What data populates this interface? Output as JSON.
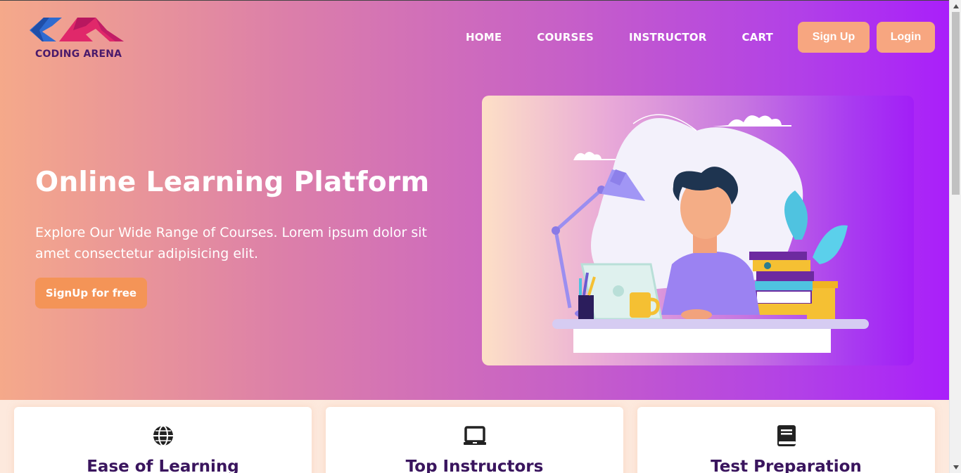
{
  "brand": {
    "name": "CODING ARENA",
    "logo_colors": {
      "left": "#2f6bd0",
      "right": "#e0286a"
    }
  },
  "nav": {
    "links": [
      "HOME",
      "COURSES",
      "INSTRUCTOR",
      "CART"
    ],
    "signup_label": "Sign Up",
    "login_label": "Login"
  },
  "hero": {
    "title": "Online Learning Platform",
    "subtitle": "Explore Our Wide Range of Courses. Lorem ipsum dolor sit amet consectetur adipisicing elit.",
    "cta_label": "SignUp for free",
    "gradient": {
      "start": "#f5a98a",
      "end": "#a91ffa"
    }
  },
  "features": [
    {
      "title": "Ease of Learning",
      "icon": "globe-icon"
    },
    {
      "title": "Top Instructors",
      "icon": "laptop-icon"
    },
    {
      "title": "Test Preparation",
      "icon": "book-icon"
    }
  ],
  "colors": {
    "button_peach": "#f7a680",
    "cta_orange": "#f49457",
    "heading_purple": "#3a155e"
  }
}
